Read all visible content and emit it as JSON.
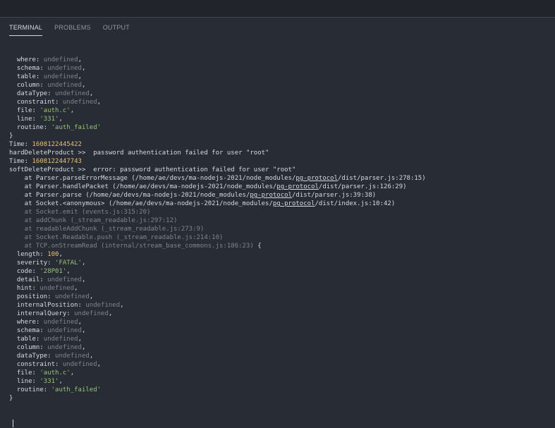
{
  "tabs": [
    {
      "label": "TERMINAL",
      "active": true
    },
    {
      "label": "PROBLEMS",
      "active": false
    },
    {
      "label": "OUTPUT",
      "active": false
    }
  ],
  "terminal": {
    "lines": [
      [
        {
          "t": "  where: ",
          "c": "k"
        },
        {
          "t": "undefined",
          "c": "dim"
        },
        {
          "t": ",",
          "c": "k"
        }
      ],
      [
        {
          "t": "  schema: ",
          "c": "k"
        },
        {
          "t": "undefined",
          "c": "dim"
        },
        {
          "t": ",",
          "c": "k"
        }
      ],
      [
        {
          "t": "  table: ",
          "c": "k"
        },
        {
          "t": "undefined",
          "c": "dim"
        },
        {
          "t": ",",
          "c": "k"
        }
      ],
      [
        {
          "t": "  column: ",
          "c": "k"
        },
        {
          "t": "undefined",
          "c": "dim"
        },
        {
          "t": ",",
          "c": "k"
        }
      ],
      [
        {
          "t": "  dataType: ",
          "c": "k"
        },
        {
          "t": "undefined",
          "c": "dim"
        },
        {
          "t": ",",
          "c": "k"
        }
      ],
      [
        {
          "t": "  constraint: ",
          "c": "k"
        },
        {
          "t": "undefined",
          "c": "dim"
        },
        {
          "t": ",",
          "c": "k"
        }
      ],
      [
        {
          "t": "  file: ",
          "c": "k"
        },
        {
          "t": "'auth.c'",
          "c": "str"
        },
        {
          "t": ",",
          "c": "k"
        }
      ],
      [
        {
          "t": "  line: ",
          "c": "k"
        },
        {
          "t": "'331'",
          "c": "str"
        },
        {
          "t": ",",
          "c": "k"
        }
      ],
      [
        {
          "t": "  routine: ",
          "c": "k"
        },
        {
          "t": "'auth_failed'",
          "c": "str"
        }
      ],
      [
        {
          "t": "}",
          "c": "k"
        }
      ],
      [
        {
          "t": "Time: ",
          "c": "k"
        },
        {
          "t": "1608122445422",
          "c": "num"
        }
      ],
      [
        {
          "t": "hardDeleteProduct >>  password authentication failed for user \"root\"",
          "c": "k"
        }
      ],
      [
        {
          "t": "Time: ",
          "c": "k"
        },
        {
          "t": "1608122447743",
          "c": "num"
        }
      ],
      [
        {
          "t": "softDeleteProduct >>  error: password authentication failed for user \"root\"",
          "c": "k"
        }
      ],
      [
        {
          "t": "    at Parser.parseErrorMessage (/home/ae/devs/ma-nodejs-2021/node_modules/",
          "c": "k"
        },
        {
          "t": "pg-protocol",
          "c": "k u"
        },
        {
          "t": "/dist/parser.js:278:15)",
          "c": "k"
        }
      ],
      [
        {
          "t": "    at Parser.handlePacket (/home/ae/devs/ma-nodejs-2021/node_modules/",
          "c": "k"
        },
        {
          "t": "pg-protocol",
          "c": "k u"
        },
        {
          "t": "/dist/parser.js:126:29)",
          "c": "k"
        }
      ],
      [
        {
          "t": "    at Parser.parse (/home/ae/devs/ma-nodejs-2021/node_modules/",
          "c": "k"
        },
        {
          "t": "pg-protocol",
          "c": "k u"
        },
        {
          "t": "/dist/parser.js:39:38)",
          "c": "k"
        }
      ],
      [
        {
          "t": "    at Socket.<anonymous> (/home/ae/devs/ma-nodejs-2021/node_modules/",
          "c": "k"
        },
        {
          "t": "pg-protocol",
          "c": "k u"
        },
        {
          "t": "/dist/index.js:10:42)",
          "c": "k"
        }
      ],
      [
        {
          "t": "    at Socket.emit (events.js:315:20)",
          "c": "dim"
        }
      ],
      [
        {
          "t": "    at addChunk (_stream_readable.js:297:12)",
          "c": "dim"
        }
      ],
      [
        {
          "t": "    at readableAddChunk (_stream_readable.js:273:9)",
          "c": "dim"
        }
      ],
      [
        {
          "t": "    at Socket.Readable.push (_stream_readable.js:214:10)",
          "c": "dim"
        }
      ],
      [
        {
          "t": "    at TCP.onStreamRead (internal/stream_base_commons.js:186:23) ",
          "c": "dim"
        },
        {
          "t": "{",
          "c": "k"
        }
      ],
      [
        {
          "t": "  length: ",
          "c": "k"
        },
        {
          "t": "100",
          "c": "num"
        },
        {
          "t": ",",
          "c": "k"
        }
      ],
      [
        {
          "t": "  severity: ",
          "c": "k"
        },
        {
          "t": "'FATAL'",
          "c": "str"
        },
        {
          "t": ",",
          "c": "k"
        }
      ],
      [
        {
          "t": "  code: ",
          "c": "k"
        },
        {
          "t": "'28P01'",
          "c": "str"
        },
        {
          "t": ",",
          "c": "k"
        }
      ],
      [
        {
          "t": "  detail: ",
          "c": "k"
        },
        {
          "t": "undefined",
          "c": "dim"
        },
        {
          "t": ",",
          "c": "k"
        }
      ],
      [
        {
          "t": "  hint: ",
          "c": "k"
        },
        {
          "t": "undefined",
          "c": "dim"
        },
        {
          "t": ",",
          "c": "k"
        }
      ],
      [
        {
          "t": "  position: ",
          "c": "k"
        },
        {
          "t": "undefined",
          "c": "dim"
        },
        {
          "t": ",",
          "c": "k"
        }
      ],
      [
        {
          "t": "  internalPosition: ",
          "c": "k"
        },
        {
          "t": "undefined",
          "c": "dim"
        },
        {
          "t": ",",
          "c": "k"
        }
      ],
      [
        {
          "t": "  internalQuery: ",
          "c": "k"
        },
        {
          "t": "undefined",
          "c": "dim"
        },
        {
          "t": ",",
          "c": "k"
        }
      ],
      [
        {
          "t": "  where: ",
          "c": "k"
        },
        {
          "t": "undefined",
          "c": "dim"
        },
        {
          "t": ",",
          "c": "k"
        }
      ],
      [
        {
          "t": "  schema: ",
          "c": "k"
        },
        {
          "t": "undefined",
          "c": "dim"
        },
        {
          "t": ",",
          "c": "k"
        }
      ],
      [
        {
          "t": "  table: ",
          "c": "k"
        },
        {
          "t": "undefined",
          "c": "dim"
        },
        {
          "t": ",",
          "c": "k"
        }
      ],
      [
        {
          "t": "  column: ",
          "c": "k"
        },
        {
          "t": "undefined",
          "c": "dim"
        },
        {
          "t": ",",
          "c": "k"
        }
      ],
      [
        {
          "t": "  dataType: ",
          "c": "k"
        },
        {
          "t": "undefined",
          "c": "dim"
        },
        {
          "t": ",",
          "c": "k"
        }
      ],
      [
        {
          "t": "  constraint: ",
          "c": "k"
        },
        {
          "t": "undefined",
          "c": "dim"
        },
        {
          "t": ",",
          "c": "k"
        }
      ],
      [
        {
          "t": "  file: ",
          "c": "k"
        },
        {
          "t": "'auth.c'",
          "c": "str"
        },
        {
          "t": ",",
          "c": "k"
        }
      ],
      [
        {
          "t": "  line: ",
          "c": "k"
        },
        {
          "t": "'331'",
          "c": "str"
        },
        {
          "t": ",",
          "c": "k"
        }
      ],
      [
        {
          "t": "  routine: ",
          "c": "k"
        },
        {
          "t": "'auth_failed'",
          "c": "str"
        }
      ],
      [
        {
          "t": "}",
          "c": "k"
        }
      ]
    ]
  },
  "colors": {
    "background": "#282c34",
    "text": "#d7dae0",
    "dim": "#7f848e",
    "string": "#98c379",
    "number": "#e5c07b"
  }
}
